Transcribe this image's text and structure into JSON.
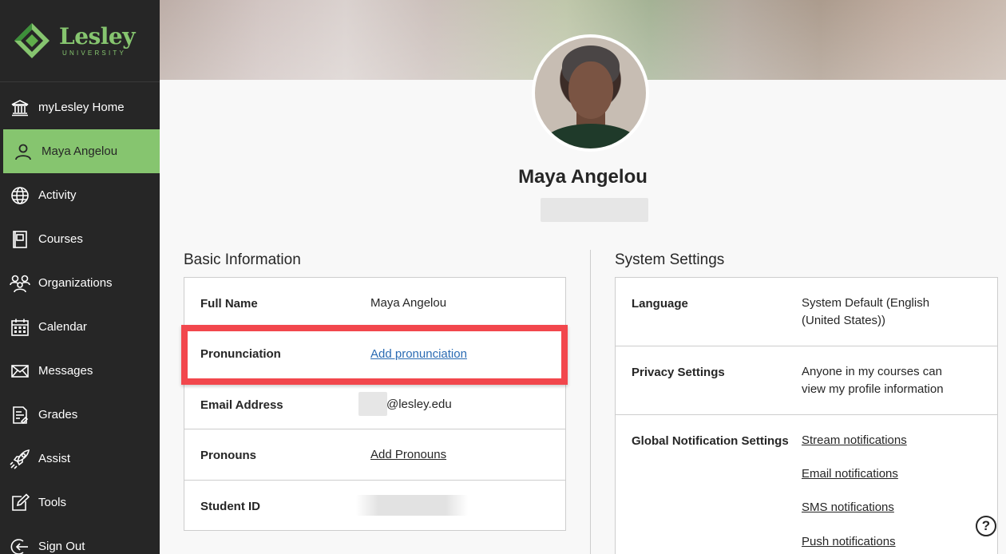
{
  "logo": {
    "name": "Lesley",
    "subtitle": "UNIVERSITY",
    "brand_color": "#86c56f"
  },
  "sidebar": {
    "items": [
      {
        "label": "myLesley Home",
        "icon": "institution-icon"
      },
      {
        "label": "Maya Angelou",
        "icon": "user-icon",
        "active": true
      },
      {
        "label": "Activity",
        "icon": "globe-icon"
      },
      {
        "label": "Courses",
        "icon": "book-icon"
      },
      {
        "label": "Organizations",
        "icon": "group-icon"
      },
      {
        "label": "Calendar",
        "icon": "calendar-icon"
      },
      {
        "label": "Messages",
        "icon": "envelope-icon"
      },
      {
        "label": "Grades",
        "icon": "grades-icon"
      },
      {
        "label": "Assist",
        "icon": "rocket-icon"
      },
      {
        "label": "Tools",
        "icon": "edit-icon"
      },
      {
        "label": "Sign Out",
        "icon": "sign-out-icon"
      }
    ]
  },
  "profile": {
    "name": "Maya Angelou"
  },
  "basic_info": {
    "title": "Basic Information",
    "rows": [
      {
        "label": "Full Name",
        "value": "Maya Angelou"
      },
      {
        "label": "Pronunciation",
        "value": "Add pronunciation"
      },
      {
        "label": "Email Address",
        "value": "@lesley.edu"
      },
      {
        "label": "Pronouns",
        "value": "Add Pronouns"
      },
      {
        "label": "Student ID",
        "value": ""
      }
    ]
  },
  "system_settings": {
    "title": "System Settings",
    "rows": [
      {
        "label": "Language",
        "value_line1": "System Default (English",
        "value_line2": "(United States))"
      },
      {
        "label": "Privacy Settings",
        "value_line1": "Anyone in my courses can",
        "value_line2": "view my profile information"
      },
      {
        "label": "Global Notification Settings",
        "links": [
          "Stream notifications",
          "Email notifications",
          "SMS notifications",
          "Push notifications"
        ]
      }
    ]
  },
  "help": {
    "symbol": "?"
  },
  "colors": {
    "sidebar_bg": "#262626",
    "active_bg": "#86c56f",
    "link": "#2a6bb3",
    "highlight": "#f2474d"
  }
}
